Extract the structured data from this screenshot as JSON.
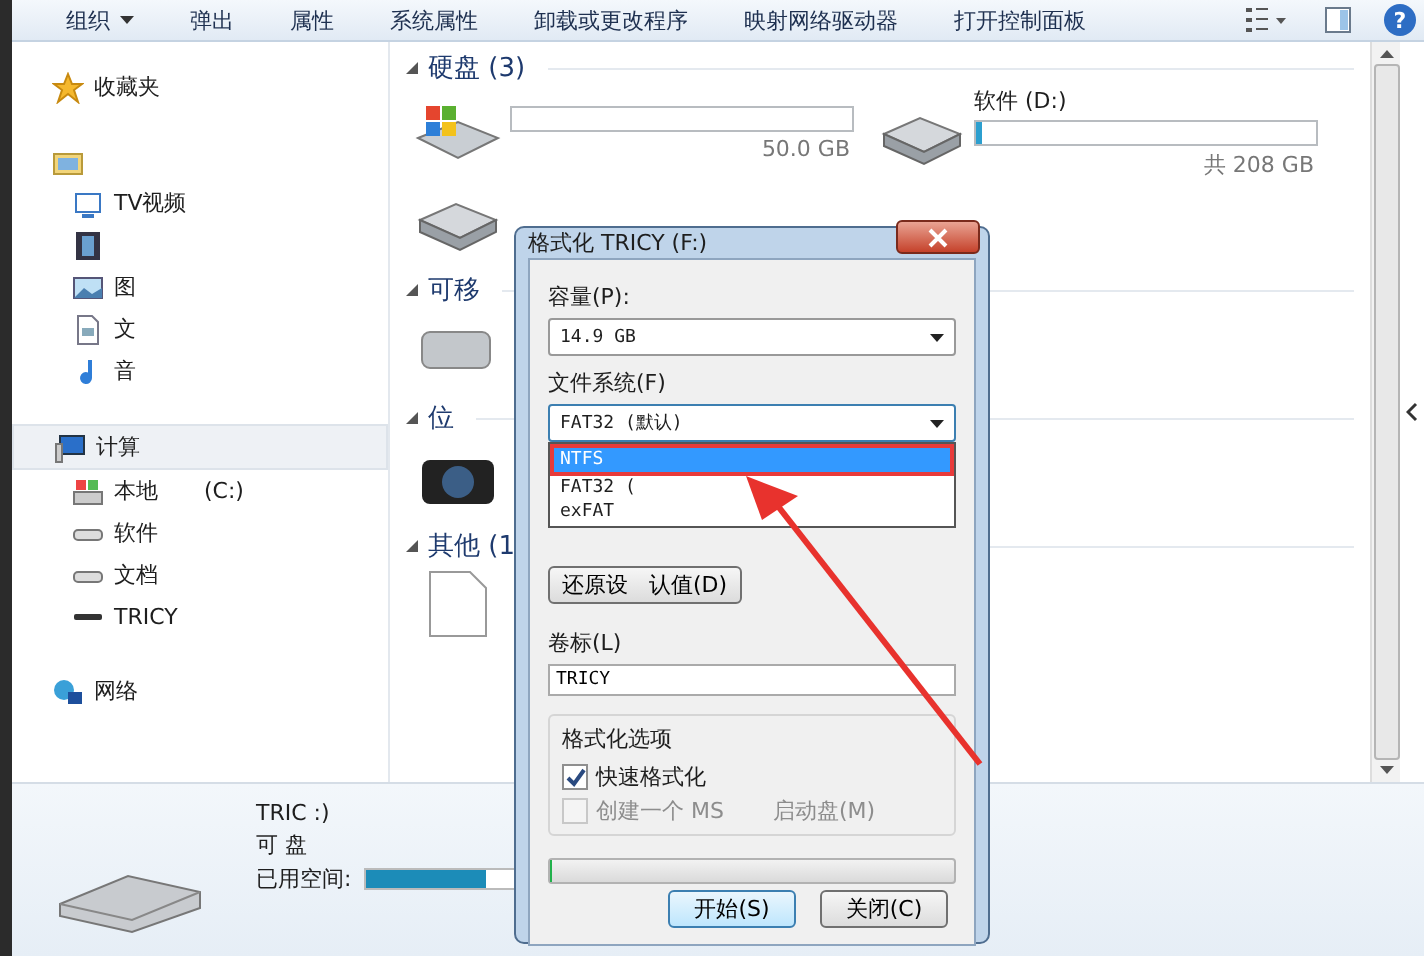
{
  "toolbar": {
    "items": [
      {
        "label": "组织",
        "menu": true
      },
      {
        "label": "弹出",
        "menu": false
      },
      {
        "label": "属性",
        "menu": false
      },
      {
        "label": "系统属性",
        "menu": false
      },
      {
        "label": "卸载或更改程序",
        "menu": false
      },
      {
        "label": "映射网络驱动器",
        "menu": false
      },
      {
        "label": "打开控制面板",
        "menu": false
      }
    ],
    "help": "?"
  },
  "sidebar": {
    "groups": [
      {
        "label": "收藏夹",
        "kind": "favorites",
        "selected": false
      },
      {
        "kind": "libraries",
        "selected": false,
        "children": [
          {
            "label": "TV视频",
            "kind": "tv"
          },
          {
            "kind": "video"
          },
          {
            "label": "图",
            "kind": "pictures"
          },
          {
            "label": "文",
            "kind": "documents"
          },
          {
            "label": "音",
            "kind": "music"
          }
        ]
      },
      {
        "label": "计算",
        "kind": "computer",
        "selected": true,
        "children": [
          {
            "label": "本地",
            "suffix": "(C:)",
            "kind": "system"
          },
          {
            "label": "软件",
            "kind": "disk"
          },
          {
            "label": "文档",
            "kind": "disk"
          },
          {
            "label": "TRICY",
            "kind": "usb"
          }
        ]
      },
      {
        "label": "网络",
        "kind": "network",
        "selected": false
      }
    ]
  },
  "sections": [
    {
      "title": "硬盘 (3)",
      "drives": [
        {
          "kind": "system",
          "info": "50.0 GB"
        },
        {
          "kind": "disk",
          "name": "软件 (D:)",
          "level": 0.02,
          "info": "共 208 GB"
        },
        {
          "kind": "disk"
        }
      ]
    },
    {
      "title": "可移",
      "drives": [
        {
          "kind": "usb"
        }
      ]
    },
    {
      "title": "位",
      "drives": [
        {
          "kind": "camera"
        }
      ]
    },
    {
      "title": "其他 (1",
      "drives": [
        {
          "kind": "file"
        }
      ]
    }
  ],
  "dialog": {
    "title": "格式化 TRICY (F:)",
    "capacity_label": "容量(P):",
    "capacity": "14.9 GB",
    "fs_label": "文件系统(F)",
    "fs_value": "FAT32 (默认)",
    "fs_options": [
      {
        "label": "NTFS",
        "selected": true
      },
      {
        "label": "FAT32 (",
        "selected": false
      },
      {
        "label": "exFAT",
        "selected": false
      }
    ],
    "restore_button": "还原设   认值(D)",
    "volume_label": "卷标(L)",
    "volume": "TRICY",
    "options_label": "格式化选项",
    "options": [
      {
        "label": "快速格式化",
        "checked": true,
        "disabled": false
      },
      {
        "label": "创建一个 MS       启动盘(M)",
        "checked": false,
        "disabled": true
      }
    ],
    "progress": {
      "level": 0
    },
    "buttons": [
      {
        "label": "开始(S)",
        "default": true
      },
      {
        "label": "关闭(C)",
        "default": false
      }
    ]
  },
  "details": {
    "name": "TRIC  :)",
    "type": "可   盘",
    "used_label": "已用空间:",
    "level": 0.6
  }
}
